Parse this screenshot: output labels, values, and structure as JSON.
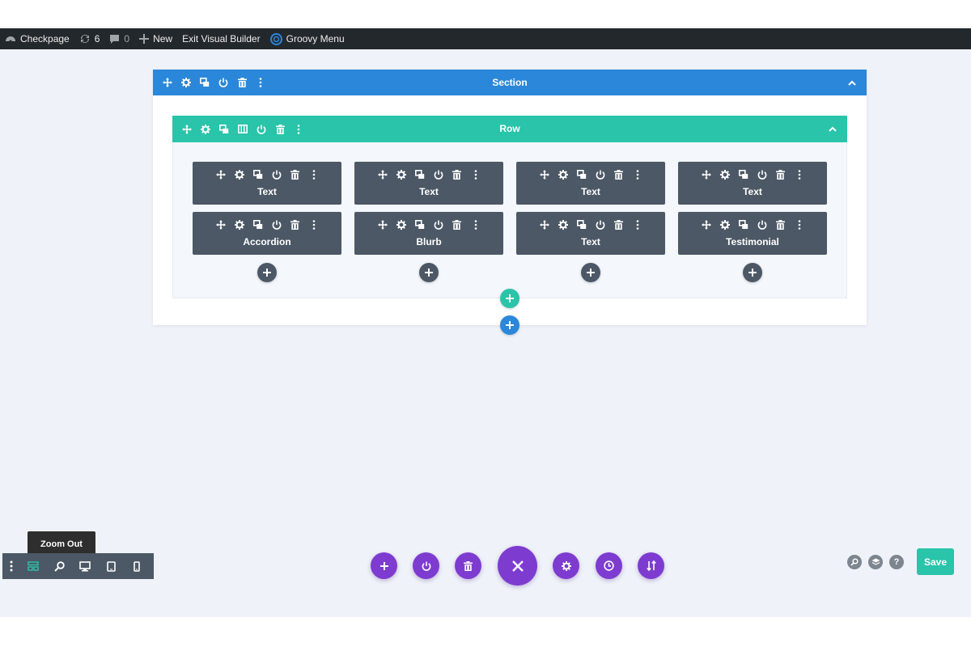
{
  "adminbar": {
    "site_name": "Checkpage",
    "updates_count": "6",
    "comments_count": "0",
    "new_label": "New",
    "exit_label": "Exit Visual Builder",
    "groovy_label": "Groovy Menu"
  },
  "section": {
    "title": "Section"
  },
  "row": {
    "title": "Row"
  },
  "modules": [
    [
      "Text",
      "Text",
      "Text",
      "Text"
    ],
    [
      "Accordion",
      "Blurb",
      "Text",
      "Testimonial"
    ]
  ],
  "viewbar": {
    "tooltip": "Zoom Out"
  },
  "save_label": "Save",
  "colors": {
    "adminbar": "#23282d",
    "section": "#2b87da",
    "row": "#29c4a9",
    "module": "#4c5866",
    "action": "#7e3bd0",
    "save": "#29c4a9"
  },
  "icons": {
    "tool_set": [
      "move-icon",
      "gear-icon",
      "duplicate-icon",
      "power-icon",
      "trash-icon",
      "more-icon"
    ],
    "row_extra": "columns-icon"
  }
}
